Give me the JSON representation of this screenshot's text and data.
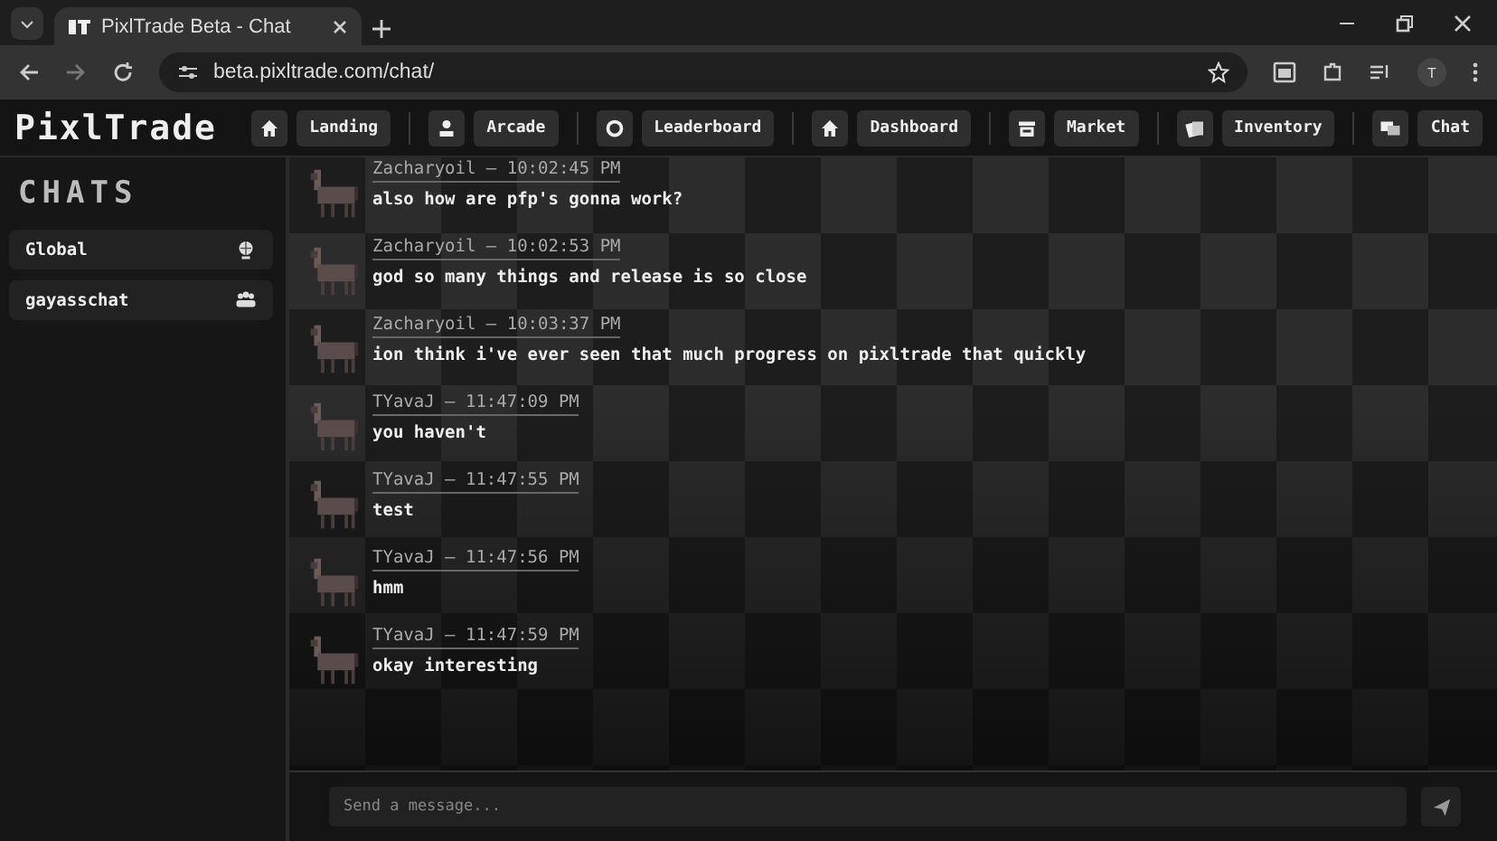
{
  "browser": {
    "tab_title": "PixlTrade Beta - Chat",
    "url": "beta.pixltrade.com/chat/",
    "profile": "T"
  },
  "app": {
    "logo": "PixlTrade",
    "nav": [
      {
        "label": "Landing"
      },
      {
        "label": "Arcade"
      },
      {
        "label": "Leaderboard"
      },
      {
        "label": "Dashboard"
      },
      {
        "label": "Market"
      },
      {
        "label": "Inventory"
      },
      {
        "label": "Chat"
      }
    ]
  },
  "sidebar": {
    "title": "CHATS",
    "chats": [
      {
        "name": "Global"
      },
      {
        "name": "gayasschat"
      }
    ]
  },
  "messages": [
    {
      "header": "Zacharyoil — 10:02:45 PM",
      "text": "also how are pfp's gonna work?"
    },
    {
      "header": "Zacharyoil — 10:02:53 PM",
      "text": "god so many things and release is so close"
    },
    {
      "header": "Zacharyoil — 10:03:37 PM",
      "text": "ion think i've ever seen that much progress on pixltrade that quickly"
    },
    {
      "header": "TYavaJ — 11:47:09 PM",
      "text": "you haven't"
    },
    {
      "header": "TYavaJ — 11:47:55 PM",
      "text": "test"
    },
    {
      "header": "TYavaJ — 11:47:56 PM",
      "text": "hmm"
    },
    {
      "header": "TYavaJ — 11:47:59 PM",
      "text": "okay interesting"
    }
  ],
  "composer": {
    "placeholder": "Send a message..."
  }
}
